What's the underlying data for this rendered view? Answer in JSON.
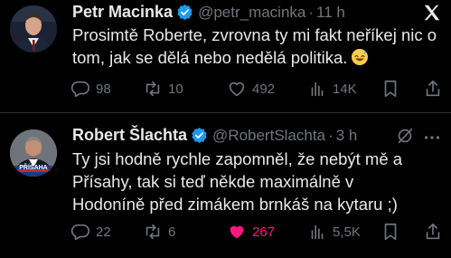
{
  "tweets": [
    {
      "name": "Petr Macinka",
      "handle": "@petr_macinka",
      "time": "11 h",
      "text": "Prosimtě Roberte, zvrovna ty mi fakt neříkej nic o tom, jak se dělá nebo nedělá politika.",
      "emoji": "sweat-smile-emoji",
      "stats": {
        "replies": "98",
        "reposts": "10",
        "likes": "492",
        "views": "14K"
      }
    },
    {
      "name": "Robert Šlachta",
      "handle": "@RobertSlachta",
      "time": "3 h",
      "avatar_label": "PŘÍSAHA",
      "text_lines": [
        "Ty jsi hodně rychle zapomněl, že nebýt mě a",
        "Přísahy, tak si teď někde maximálně v",
        "Hodoníně před zimákem brnkáš na kytaru ;)"
      ],
      "stats": {
        "replies": "22",
        "reposts": "6",
        "likes": "267",
        "views": "5,5K"
      }
    }
  ],
  "colors": {
    "background": "#000000",
    "text": "#e7e9ea",
    "muted": "#71767b",
    "verified": "#1d9bf0",
    "like": "#f91880",
    "divider": "#2f3336"
  }
}
